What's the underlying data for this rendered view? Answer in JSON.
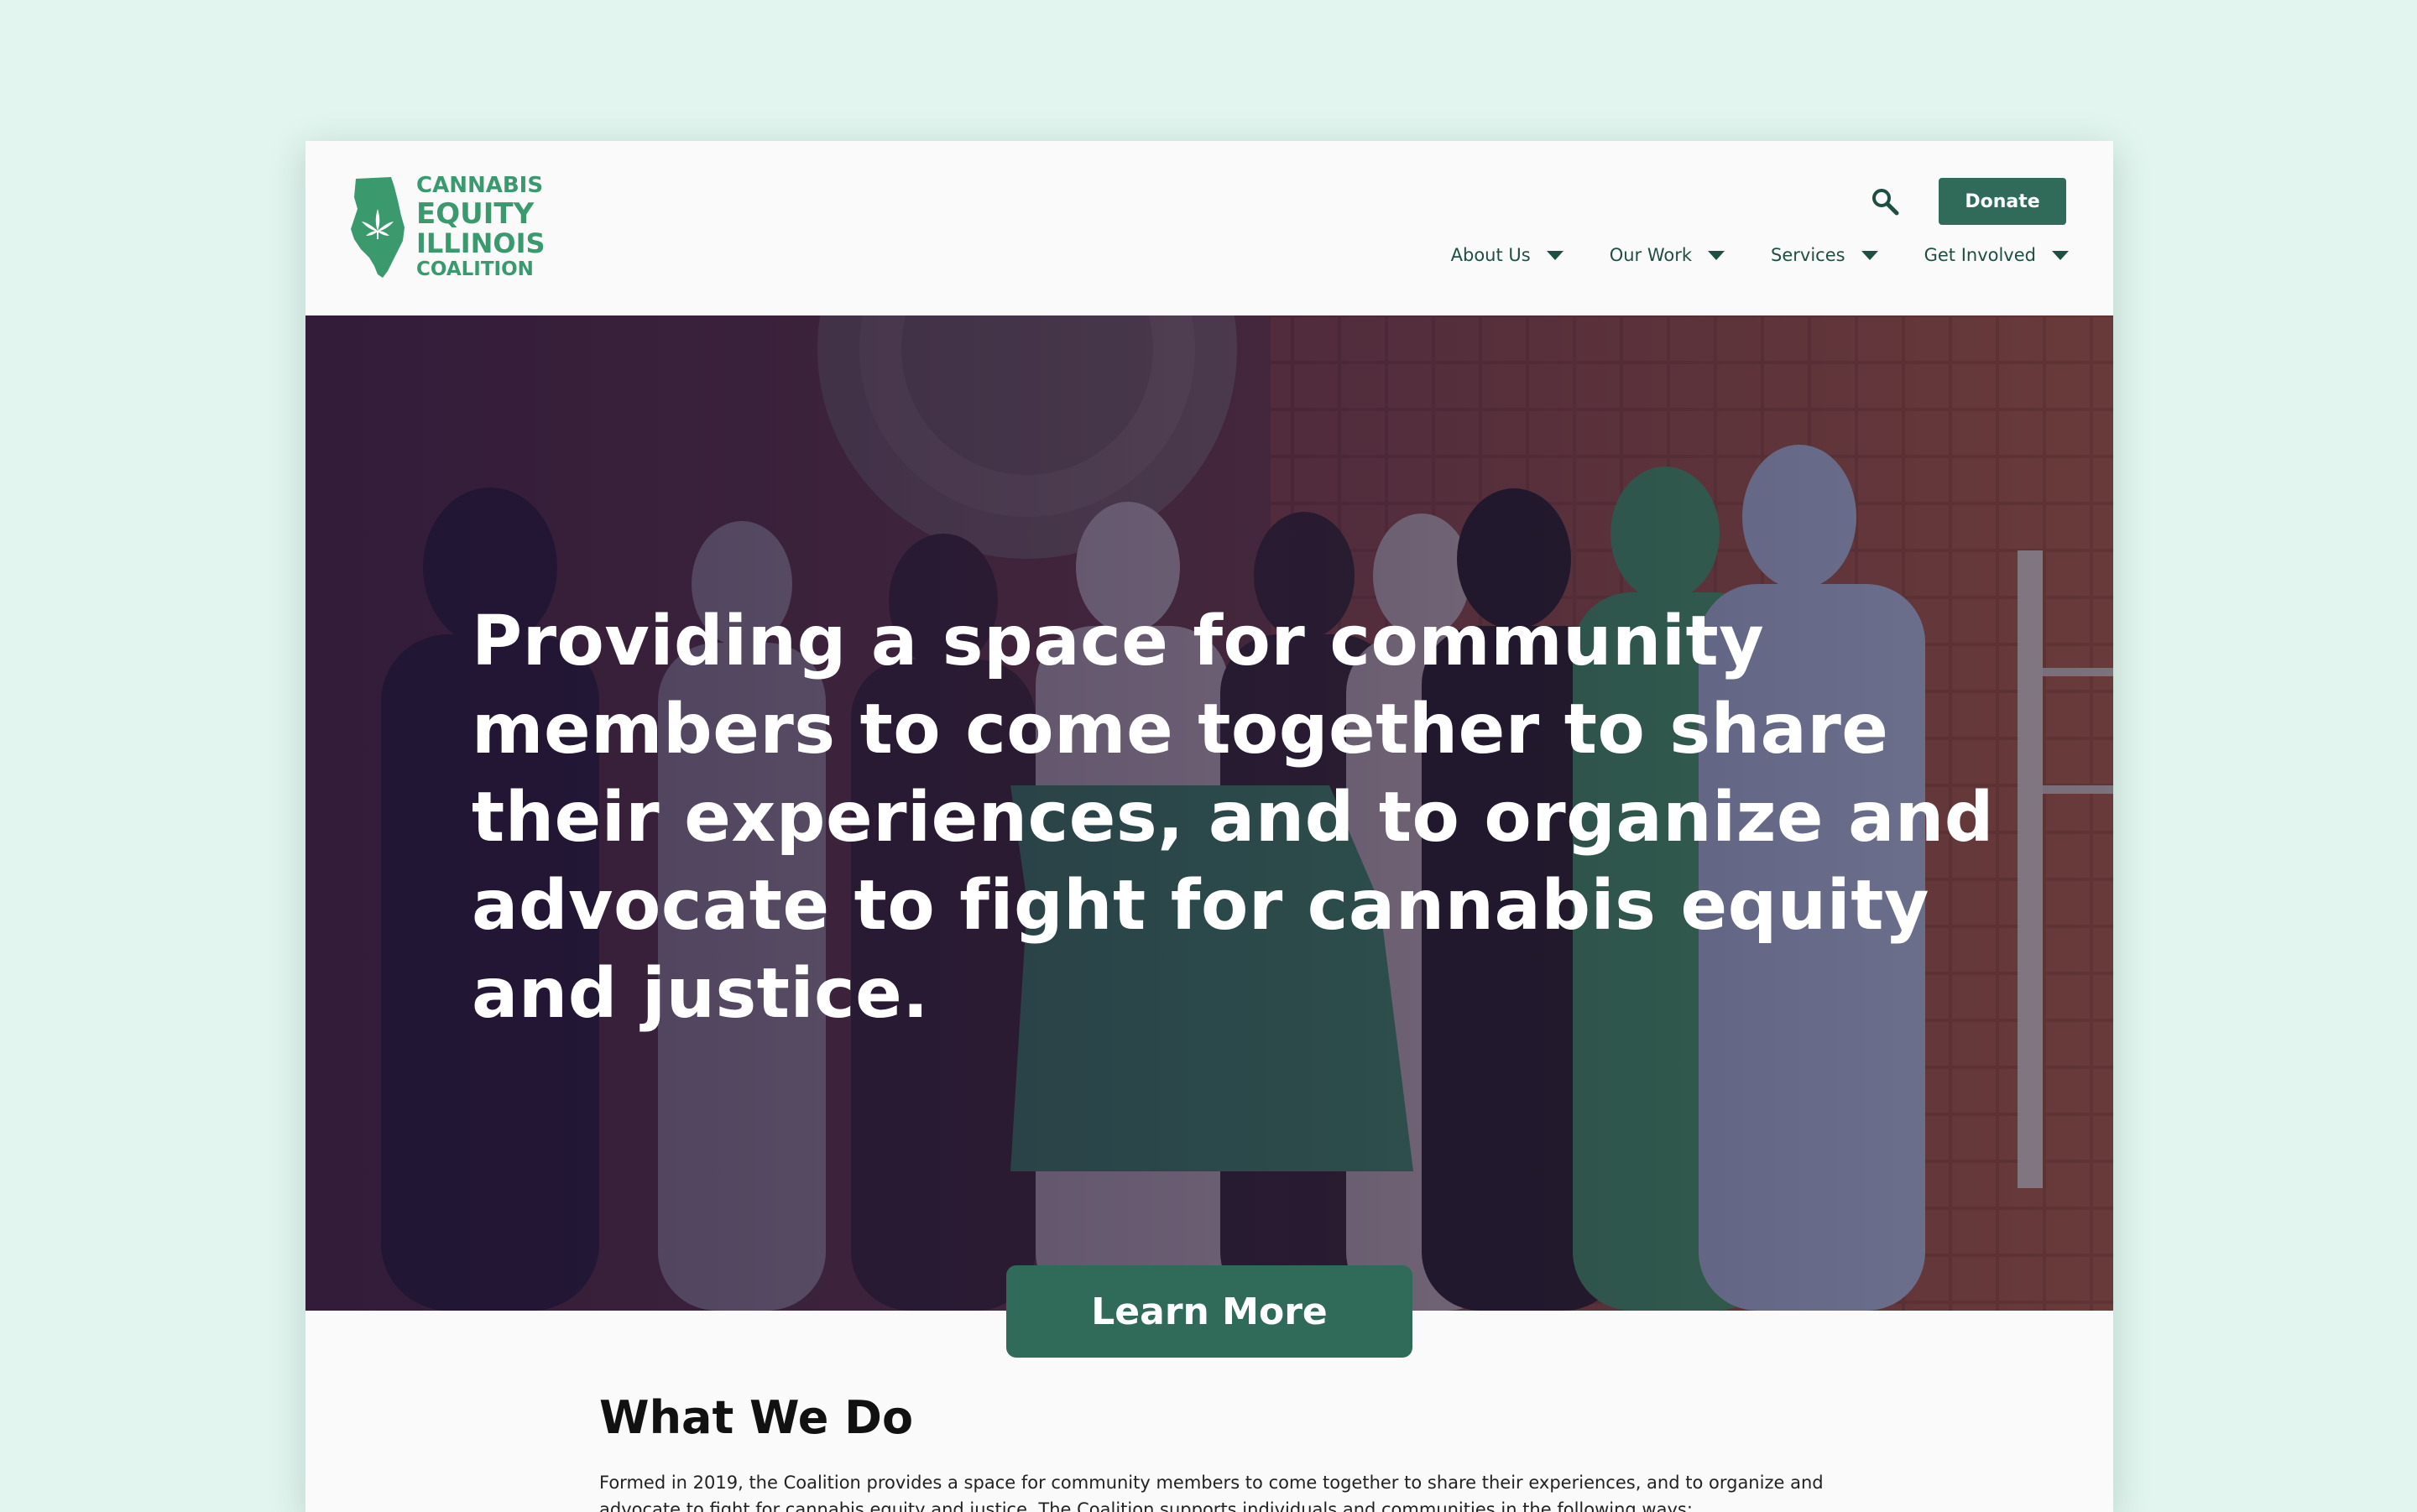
{
  "brand": {
    "logo_lines": [
      "CANNABIS",
      "EQUITY",
      "ILLINOIS",
      "COALITION"
    ],
    "color": "#3a9a6e"
  },
  "header": {
    "search_icon": "search-icon",
    "donate_label": "Donate",
    "nav": [
      {
        "label": "About Us",
        "icon": "chevron-down-icon"
      },
      {
        "label": "Our Work",
        "icon": "chevron-down-icon"
      },
      {
        "label": "Services",
        "icon": "chevron-down-icon"
      },
      {
        "label": "Get Involved",
        "icon": "chevron-down-icon"
      }
    ]
  },
  "hero": {
    "headline": "Providing a space for community members to come together to share their experiences, and to organize and advocate to fight for cannabis equity and justice.",
    "cta_label": "Learn More"
  },
  "what_we_do": {
    "heading": "What We Do",
    "body": "Formed in 2019, the Coalition provides a space for community members to come together to share their experiences, and to organize and advocate to fight for cannabis equity and justice. The Coalition supports individuals and communities in the following ways:"
  },
  "colors": {
    "accent": "#2f6b58",
    "brand_green": "#3a9a6e",
    "page_bg": "#e2f5ef"
  }
}
